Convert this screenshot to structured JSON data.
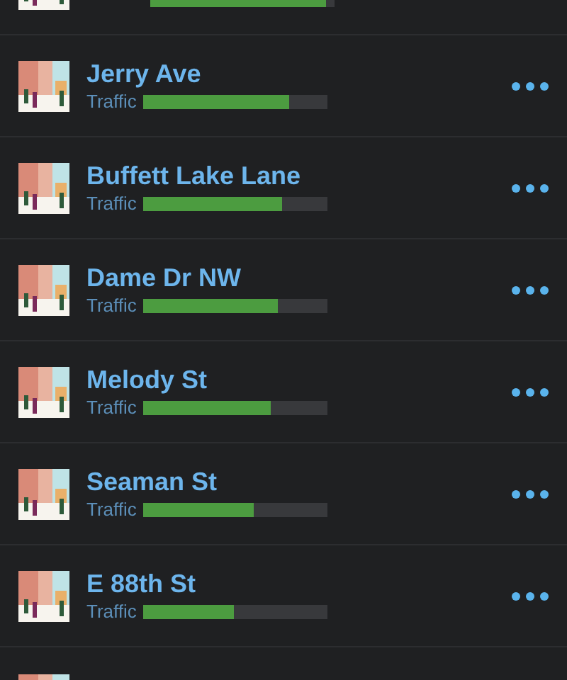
{
  "rows": [
    {
      "kind": "cut_top",
      "level": 0.95
    },
    {
      "kind": "full",
      "name": "Jerry Ave",
      "label": "Traffic",
      "level": 0.79
    },
    {
      "kind": "full",
      "name": "Buffett Lake Lane",
      "label": "Traffic",
      "level": 0.75
    },
    {
      "kind": "full",
      "name": "Dame Dr NW",
      "label": "Traffic",
      "level": 0.73
    },
    {
      "kind": "full",
      "name": "Melody St",
      "label": "Traffic",
      "level": 0.69
    },
    {
      "kind": "full",
      "name": "Seaman St",
      "label": "Traffic",
      "level": 0.6
    },
    {
      "kind": "full",
      "name": "E 88th St",
      "label": "Traffic",
      "level": 0.49
    },
    {
      "kind": "cut_bottom"
    }
  ]
}
